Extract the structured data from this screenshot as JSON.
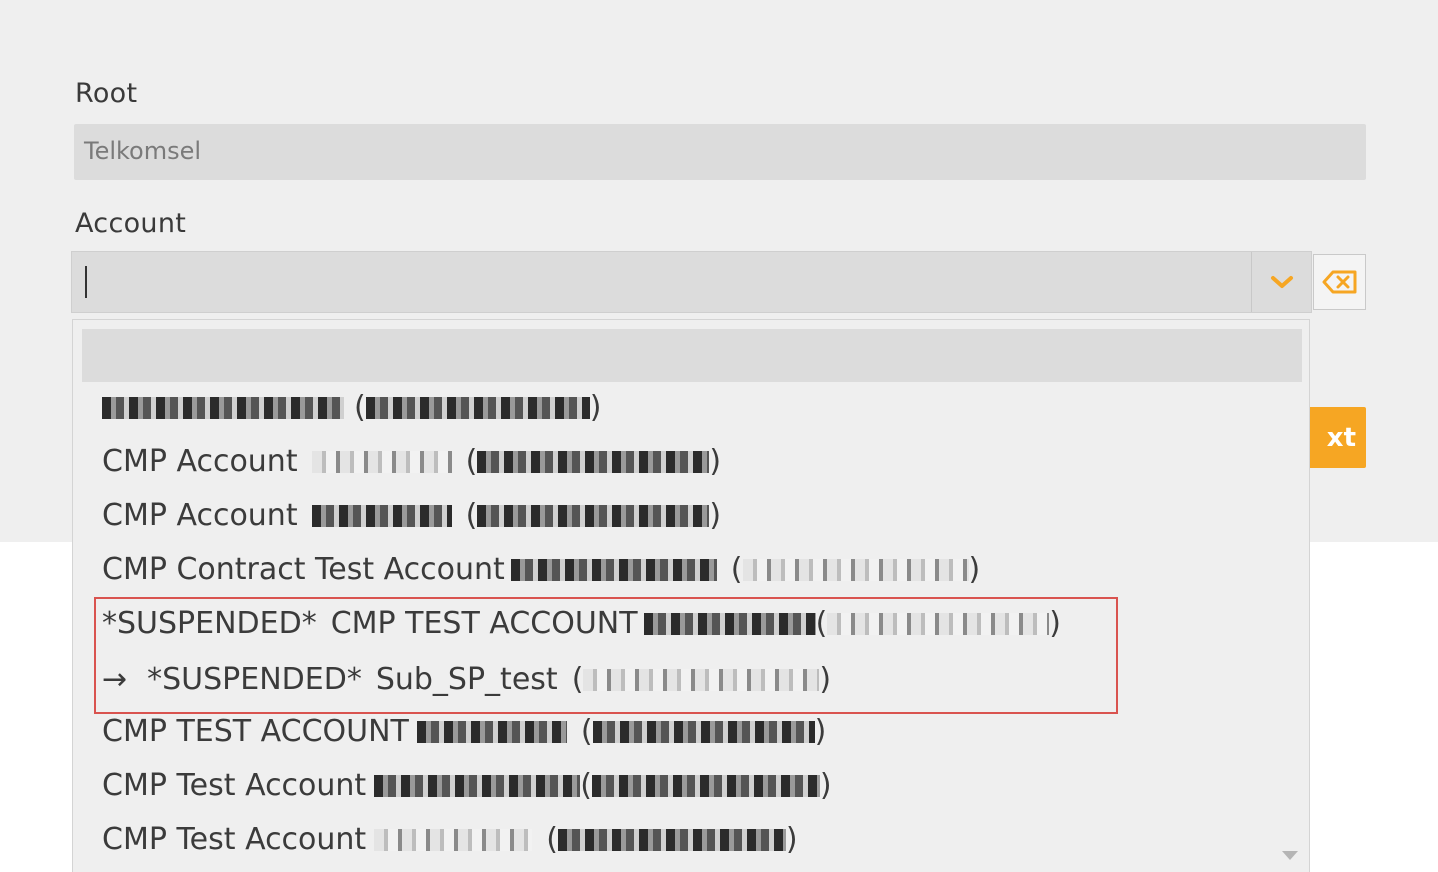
{
  "form": {
    "root_label": "Root",
    "root_value": "Telkomsel",
    "account_label": "Account",
    "account_input_value": "",
    "next_label": "xt"
  },
  "dropdown": {
    "options": [
      {
        "prefix": "",
        "name": "",
        "paren_open": "(",
        "paren_close": ")"
      },
      {
        "prefix": "",
        "name": "CMP Account",
        "paren_open": "(",
        "paren_close": ")"
      },
      {
        "prefix": "",
        "name": "CMP Account",
        "paren_open": "(",
        "paren_close": ")"
      },
      {
        "prefix": "",
        "name": "CMP Contract Test Account",
        "paren_open": "(",
        "paren_close": ")"
      },
      {
        "prefix": "*SUSPENDED*",
        "name": "CMP TEST ACCOUNT",
        "paren_open": "(",
        "paren_close": ")"
      },
      {
        "prefix": "→",
        "status": "*SUSPENDED*",
        "name": "Sub_SP_test",
        "paren_open": "(",
        "paren_close": ")"
      },
      {
        "prefix": "",
        "name": "CMP TEST ACCOUNT",
        "paren_open": "(",
        "paren_close": ")"
      },
      {
        "prefix": "",
        "name": "CMP Test Account",
        "paren_open": "(",
        "paren_close": ")"
      },
      {
        "prefix": "",
        "name": "CMP Test Account",
        "paren_open": "(",
        "paren_close": ")"
      }
    ]
  },
  "icons": {
    "dropdown": "chevron-down-icon",
    "clear": "backspace-icon",
    "scroll": "scroll-down-arrow-icon"
  },
  "colors": {
    "accent": "#f6a623",
    "highlight": "#d9534f"
  }
}
